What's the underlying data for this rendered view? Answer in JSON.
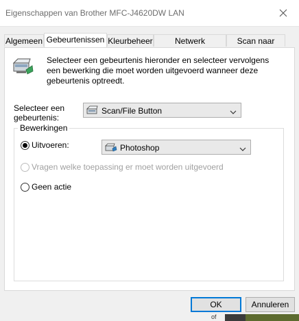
{
  "window": {
    "title": "Eigenschappen van Brother MFC-J4620DW LAN"
  },
  "tabs": [
    {
      "label": "Algemeen",
      "active": false
    },
    {
      "label": "Gebeurtenissen",
      "active": true
    },
    {
      "label": "Kleurbeheer",
      "active": false
    },
    {
      "label": "Netwerk instellingen",
      "active": false
    },
    {
      "label": "Scan naar Knop",
      "active": false
    }
  ],
  "intro": {
    "text": "Selecteer een gebeurtenis hieronder en selecteer vervolgens een bewerking die moet worden uitgevoerd wanneer deze gebeurtenis optreedt.",
    "icon": "scanner-icon"
  },
  "event": {
    "label": "Selecteer een gebeurtenis:",
    "selected": "Scan/File Button",
    "icon": "scanner-small-icon"
  },
  "actions": {
    "legend": "Bewerkingen",
    "run_label": "Uitvoeren:",
    "run_checked": true,
    "app_selected": "Photoshop",
    "app_icon": "photoshop-icon",
    "ask_label": "Vragen welke toepassing er moet worden uitgevoerd",
    "ask_enabled": false,
    "none_label": "Geen actie"
  },
  "buttons": {
    "ok": "OK",
    "cancel": "Annuleren"
  },
  "background": {
    "partial_text": "of"
  },
  "colors": {
    "accent": "#0078d7",
    "panel": "#ffffff",
    "chrome": "#f0f0f0"
  }
}
